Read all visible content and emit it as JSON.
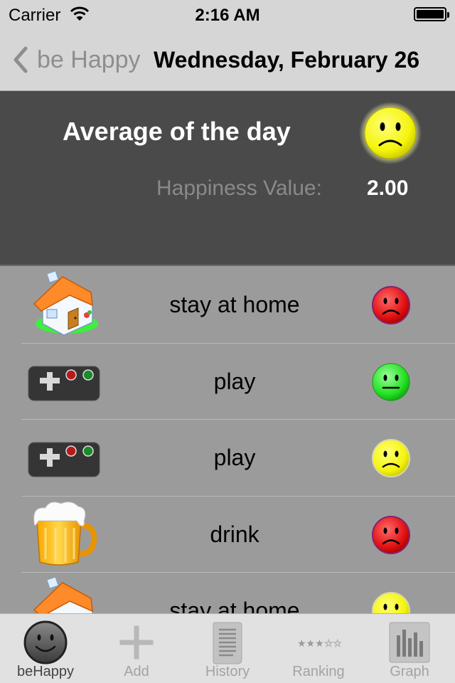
{
  "status_bar": {
    "carrier": "Carrier",
    "time": "2:16 AM"
  },
  "nav": {
    "back_label": "be Happy",
    "title": "Wednesday, February 26"
  },
  "summary": {
    "title": "Average of the day",
    "face_icon": "sad-face-yellow-icon",
    "value_label": "Happiness Value:",
    "value": "2.00"
  },
  "activities": [
    {
      "label": "stay at home",
      "icon": "house-icon",
      "mood_icon": "sad-face-red-icon",
      "mood_color": "#e8171a"
    },
    {
      "label": "play",
      "icon": "game-controller-icon",
      "mood_icon": "neutral-face-green-icon",
      "mood_color": "#2fe82f"
    },
    {
      "label": "play",
      "icon": "game-controller-icon",
      "mood_icon": "sad-face-yellow-icon",
      "mood_color": "#f2f20d"
    },
    {
      "label": "drink",
      "icon": "beer-mug-icon",
      "mood_icon": "sad-face-red-icon",
      "mood_color": "#e8171a"
    },
    {
      "label": "stay at home",
      "icon": "house-icon",
      "mood_icon": "sad-face-yellow-icon",
      "mood_color": "#f2f20d"
    }
  ],
  "tabs": [
    {
      "label": "beHappy",
      "icon": "smiley-face-icon",
      "active": true
    },
    {
      "label": "Add",
      "icon": "plus-icon",
      "active": false
    },
    {
      "label": "History",
      "icon": "scroll-icon",
      "active": false
    },
    {
      "label": "Ranking",
      "icon": "stars-icon",
      "active": false
    },
    {
      "label": "Graph",
      "icon": "bar-chart-icon",
      "active": false
    }
  ],
  "colors": {
    "summary_bg": "#4a4a4a",
    "list_bg": "#9b9b9b",
    "bar_bg": "#d6d6d6"
  }
}
